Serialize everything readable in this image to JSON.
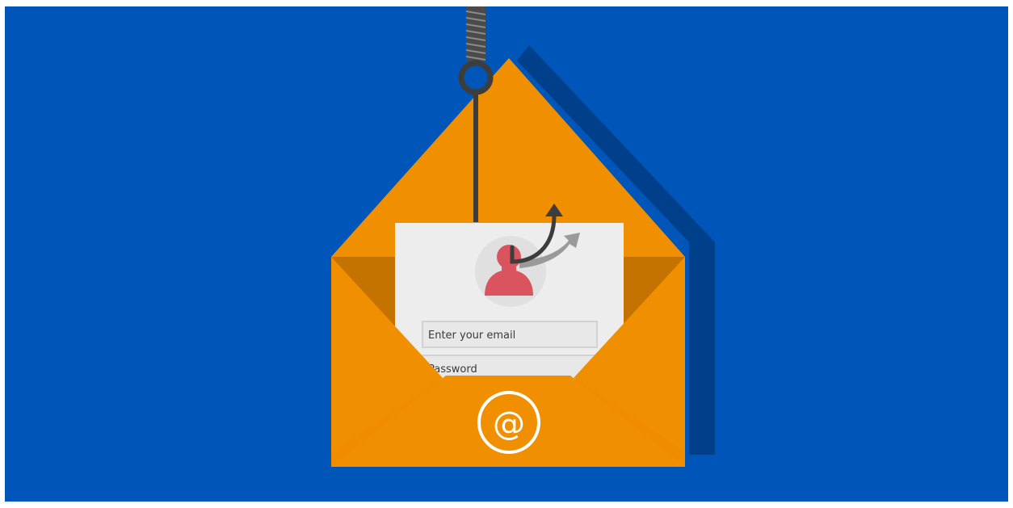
{
  "illustration": {
    "subject": "phishing-email",
    "background_color": "#0056b8",
    "envelope_color": "#f09000",
    "envelope_dark_color": "#c47200",
    "shadow_color": "#003f8a",
    "hook_color": "#3d3d3d",
    "avatar_color": "#d9545f",
    "letter_color": "#ededed"
  },
  "login_form": {
    "email_placeholder": "Enter your email",
    "password_placeholder": "Password"
  },
  "envelope": {
    "symbol": "@",
    "symbol_icon": "at-sign-icon"
  }
}
